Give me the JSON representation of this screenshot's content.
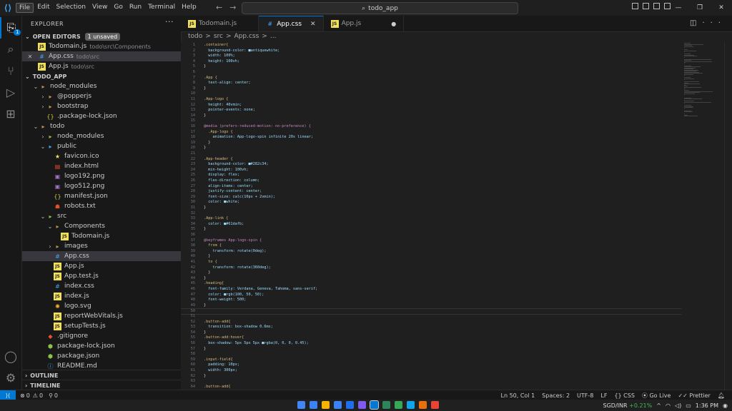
{
  "menu": [
    "File",
    "Edit",
    "Selection",
    "View",
    "Go",
    "Run",
    "Terminal",
    "Help"
  ],
  "search": {
    "text": "todo_app"
  },
  "explorer": {
    "title": "EXPLORER",
    "open_editors": {
      "label": "OPEN EDITORS",
      "unsaved": "1 unsaved",
      "items": [
        {
          "name": "Todomain.js",
          "desc": "todo\\src\\Components"
        },
        {
          "name": "App.css",
          "desc": "todo\\src"
        },
        {
          "name": "App.js",
          "desc": "todo\\src"
        }
      ]
    },
    "project": "TODO_APP",
    "tree": [
      {
        "label": "node_modules",
        "depth": 1,
        "type": "folder",
        "open": true
      },
      {
        "label": "@popperjs",
        "depth": 2,
        "type": "folder",
        "open": false
      },
      {
        "label": "bootstrap",
        "depth": 2,
        "type": "folder",
        "open": false
      },
      {
        "label": ".package-lock.json",
        "depth": 2,
        "type": "json"
      },
      {
        "label": "todo",
        "depth": 1,
        "type": "folder",
        "open": true
      },
      {
        "label": "node_modules",
        "depth": 2,
        "type": "folder-green",
        "open": false
      },
      {
        "label": "public",
        "depth": 2,
        "type": "folder-blue",
        "open": true
      },
      {
        "label": "favicon.ico",
        "depth": 3,
        "type": "star"
      },
      {
        "label": "index.html",
        "depth": 3,
        "type": "html"
      },
      {
        "label": "logo192.png",
        "depth": 3,
        "type": "img"
      },
      {
        "label": "logo512.png",
        "depth": 3,
        "type": "img"
      },
      {
        "label": "manifest.json",
        "depth": 3,
        "type": "json"
      },
      {
        "label": "robots.txt",
        "depth": 3,
        "type": "robot"
      },
      {
        "label": "src",
        "depth": 2,
        "type": "folder-green",
        "open": true
      },
      {
        "label": "Components",
        "depth": 3,
        "type": "folder",
        "open": true
      },
      {
        "label": "Todomain.js",
        "depth": 4,
        "type": "js"
      },
      {
        "label": "images",
        "depth": 3,
        "type": "folder",
        "open": false
      },
      {
        "label": "App.css",
        "depth": 3,
        "type": "css",
        "selected": true
      },
      {
        "label": "App.js",
        "depth": 3,
        "type": "js"
      },
      {
        "label": "App.test.js",
        "depth": 3,
        "type": "js"
      },
      {
        "label": "index.css",
        "depth": 3,
        "type": "css"
      },
      {
        "label": "index.js",
        "depth": 3,
        "type": "js"
      },
      {
        "label": "logo.svg",
        "depth": 3,
        "type": "svg"
      },
      {
        "label": "reportWebVitals.js",
        "depth": 3,
        "type": "js"
      },
      {
        "label": "setupTests.js",
        "depth": 3,
        "type": "js"
      },
      {
        "label": ".gitignore",
        "depth": 2,
        "type": "git"
      },
      {
        "label": "package-lock.json",
        "depth": 2,
        "type": "npm"
      },
      {
        "label": "package.json",
        "depth": 2,
        "type": "npm"
      },
      {
        "label": "README.md",
        "depth": 2,
        "type": "info"
      }
    ],
    "outline": "OUTLINE",
    "timeline": "TIMELINE"
  },
  "tabs": [
    {
      "name": "Todomain.js",
      "type": "js"
    },
    {
      "name": "App.css",
      "type": "css",
      "active": true
    },
    {
      "name": "App.js",
      "type": "js"
    }
  ],
  "breadcrumb": [
    "todo",
    ">",
    "src",
    ">",
    "App.css",
    ">",
    "..."
  ],
  "code": [
    [
      ".container{",
      "sel"
    ],
    [
      "  background-color: ■antiquewhite;",
      "prop"
    ],
    [
      "  width: 100%;",
      "prop"
    ],
    [
      "  height: 100vh;",
      "prop"
    ],
    [
      "}",
      ""
    ],
    [
      "",
      ""
    ],
    [
      ".App {",
      "sel"
    ],
    [
      "  text-align: center;",
      "prop"
    ],
    [
      "}",
      ""
    ],
    [
      "",
      ""
    ],
    [
      ".App-logo {",
      "sel"
    ],
    [
      "  height: 40vmin;",
      "prop"
    ],
    [
      "  pointer-events: none;",
      "prop"
    ],
    [
      "}",
      ""
    ],
    [
      "",
      ""
    ],
    [
      "@media (prefers-reduced-motion: no-preference) {",
      "kw"
    ],
    [
      "  .App-logo {",
      "sel"
    ],
    [
      "    animation: App-logo-spin infinite 20s linear;",
      "prop"
    ],
    [
      "  }",
      ""
    ],
    [
      "}",
      ""
    ],
    [
      "",
      ""
    ],
    [
      ".App-header {",
      "sel"
    ],
    [
      "  background-color: ■#282c34;",
      "prop"
    ],
    [
      "  min-height: 100vh;",
      "prop"
    ],
    [
      "  display: flex;",
      "prop"
    ],
    [
      "  flex-direction: column;",
      "prop"
    ],
    [
      "  align-items: center;",
      "prop"
    ],
    [
      "  justify-content: center;",
      "prop"
    ],
    [
      "  font-size: calc(10px + 2vmin);",
      "prop"
    ],
    [
      "  color: ■white;",
      "prop"
    ],
    [
      "}",
      ""
    ],
    [
      "",
      ""
    ],
    [
      ".App-link {",
      "sel"
    ],
    [
      "  color: ■#61dafb;",
      "prop"
    ],
    [
      "}",
      ""
    ],
    [
      "",
      ""
    ],
    [
      "@keyframes App-logo-spin {",
      "kw"
    ],
    [
      "  from {",
      "sel"
    ],
    [
      "    transform: rotate(0deg);",
      "prop"
    ],
    [
      "  }",
      ""
    ],
    [
      "  to {",
      "sel"
    ],
    [
      "    transform: rotate(360deg);",
      "prop"
    ],
    [
      "  }",
      ""
    ],
    [
      "}",
      ""
    ],
    [
      ".heading{",
      "sel"
    ],
    [
      "  font-family: Verdana, Geneva, Tahoma, sans-serif;",
      "prop"
    ],
    [
      "  color: ■rgb(100, 50, 50);",
      "prop"
    ],
    [
      "  font-weight: 500;",
      "prop"
    ],
    [
      "}",
      ""
    ],
    [
      "",
      ""
    ],
    [
      "",
      ""
    ],
    [
      ".button-add{",
      "sel"
    ],
    [
      "  transition: box-shadow 0.6ms;",
      "prop"
    ],
    [
      "}",
      ""
    ],
    [
      ".button-add:hover{",
      "sel"
    ],
    [
      "  box-shadow: 5px 5px 5px ■rgba(0, 0, 0, 0.45);",
      "prop"
    ],
    [
      "}",
      ""
    ],
    [
      "",
      ""
    ],
    [
      ".input-field{",
      "sel"
    ],
    [
      "  padding: 10px;",
      "prop"
    ],
    [
      "  width: 300px;",
      "prop"
    ],
    [
      "}",
      ""
    ],
    [
      "",
      ""
    ],
    [
      ".button-add{",
      "sel"
    ],
    [
      "  padding: 5px;",
      "prop"
    ],
    [
      "",
      ""
    ],
    [
      "}",
      ""
    ],
    [
      ".test{",
      "sel"
    ],
    [
      "  display: inline-block;",
      "prop"
    ],
    [
      "",
      ""
    ]
  ],
  "status": {
    "errors": "0",
    "warnings": "0",
    "ports": "0",
    "position": "Ln 50, Col 1",
    "spaces": "Spaces: 2",
    "encoding": "UTF-8",
    "eol": "LF",
    "lang": "CSS",
    "golive": "Go Live",
    "prettier": "Prettier"
  },
  "taskbar": {
    "currency": "SGD/INR",
    "change": "+0.21%",
    "time": "1:36 PM",
    "apps": [
      "#4285f4",
      "#3b82f6",
      "#f4b400",
      "#3b82f6",
      "#1f6feb",
      "#7f5af0",
      "#0078d4",
      "#2f855a",
      "#34a853",
      "#0ea5e9",
      "#e8710a",
      "#ea4335"
    ]
  }
}
